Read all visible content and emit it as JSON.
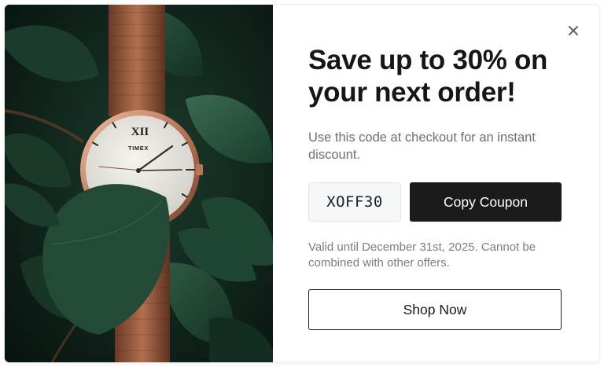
{
  "promo": {
    "headline": "Save up to 30% on your next order!",
    "subtext": "Use this code at checkout for an instant discount.",
    "coupon_code": "XOFF30",
    "copy_button_label": "Copy Coupon",
    "validity_note": "Valid until December 31st, 2025. Cannot be combined with other offers.",
    "shop_button_label": "Shop Now",
    "close_icon": "close-icon",
    "close_glyph": "×"
  },
  "image": {
    "brand_on_dial": "TIMEX",
    "dial_numeral": "XII"
  },
  "colors": {
    "primary_button_bg": "#1b1b1b",
    "primary_button_text": "#ffffff",
    "headline_text": "#14161b",
    "muted_text": "#6b6f76",
    "coupon_bg": "#f6f7f9"
  }
}
